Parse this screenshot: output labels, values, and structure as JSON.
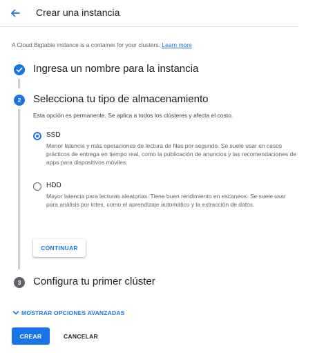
{
  "header": {
    "title": "Crear una instancia",
    "back_icon": "arrow-left-icon"
  },
  "intro": {
    "text": "A Cloud Bigtable instance is a container for your clusters.",
    "link": "Learn more"
  },
  "steps": [
    {
      "number": "",
      "title": "Ingresa un nombre para la instancia",
      "status": "completed",
      "icon": "check-circle-icon"
    },
    {
      "number": "2",
      "title": "Selecciona tu tipo de almacenamiento",
      "status": "active"
    },
    {
      "number": "3",
      "title": "Configura tu primer clúster",
      "status": "pending"
    }
  ],
  "storage": {
    "description": "Esta opción es permanente. Se aplica a todos los clústeres y afecta el costo.",
    "selected": "SSD",
    "options": [
      {
        "label": "SSD",
        "description": "Menor latencia y más operaciones de lectura de filas por segundo. Se suele usar en casos prácticos de entrega en tiempo real, como la publicación de anuncios y las recomendaciones de apps para dispositivos móviles."
      },
      {
        "label": "HDD",
        "description": "Mayor latencia para lecturas aleatorias. Tiene buen rendimiento en escaneos. Se suele usar para análisis por lotes, como el aprendizaje automático y la extracción de datos."
      }
    ],
    "continue_label": "CONTINUAR"
  },
  "advanced": {
    "label": "MOSTRAR OPCIONES AVANZADAS",
    "icon": "chevron-down-icon"
  },
  "actions": {
    "create_label": "CREAR",
    "cancel_label": "CANCELAR"
  },
  "colors": {
    "accent": "#1a73e8",
    "pending": "#5f6368",
    "text": "#202124",
    "secondary_text": "#5f6368"
  }
}
